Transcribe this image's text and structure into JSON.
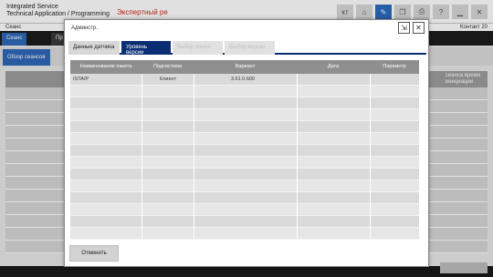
{
  "app": {
    "title_line1": "Integrated Service",
    "title_line2": "Technical Application / Programming",
    "mode_label": "Экспертный ре"
  },
  "toolbar": {
    "items": [
      {
        "icon": "keyboard-icon",
        "label": "кт"
      },
      {
        "icon": "home-icon",
        "label": "⌂"
      },
      {
        "icon": "wrench-icon",
        "label": "✎"
      },
      {
        "icon": "copy-icon",
        "label": "❐"
      },
      {
        "icon": "print-icon",
        "label": "⎙"
      },
      {
        "icon": "help-icon",
        "label": "?"
      },
      {
        "icon": "minimize-icon",
        "label": "▁"
      },
      {
        "icon": "close-icon",
        "label": "✕"
      }
    ]
  },
  "statusbar": {
    "left": "Сеанс",
    "right": "Контакт 20"
  },
  "background": {
    "nav_tab": "Сеанс",
    "nav_tab2": "Пр",
    "sub_tab": "Обзор сеансов",
    "column_right": "сеанса время\nинициации"
  },
  "modal": {
    "title": "Админстр.",
    "export_icon": "⇲",
    "close_icon": "✕",
    "tabs": [
      {
        "label": "Данные датчика",
        "state": "normal"
      },
      {
        "label": "Уровень версии",
        "state": "active"
      },
      {
        "label": "Выбор языка",
        "state": "disabled"
      },
      {
        "label": "Выбор версии",
        "state": "disabled"
      }
    ],
    "columns": [
      "Наименование пакета",
      "Подсистема",
      "Вариант",
      "Дата",
      "Параметр"
    ],
    "rows": [
      [
        "ISTA/P",
        "Клиент",
        "3.61.0.600",
        "",
        ""
      ]
    ],
    "cancel_label": "Отменить"
  },
  "footer": {
    "button_label": ""
  }
}
